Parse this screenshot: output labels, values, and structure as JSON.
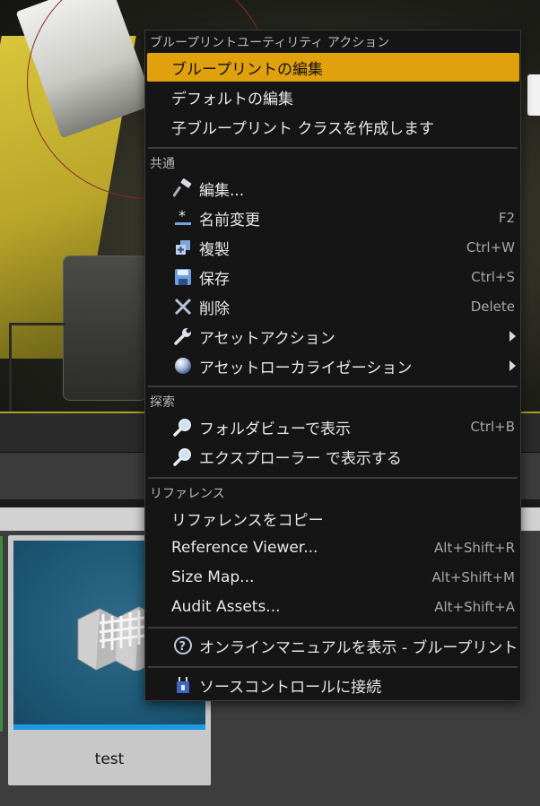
{
  "menu": {
    "sections": {
      "blueprint": "ブループリントユーティリティ アクション",
      "common": "共通",
      "explore": "探索",
      "reference": "リファレンス"
    },
    "blueprint_items": [
      {
        "label": "ブループリントの編集"
      },
      {
        "label": "デフォルトの編集"
      },
      {
        "label": "子ブループリント クラスを作成します"
      }
    ],
    "common_items": [
      {
        "label": "編集...",
        "shortcut": "",
        "icon": "hammer-icon"
      },
      {
        "label": "名前変更",
        "shortcut": "F2",
        "icon": "rename-star-icon"
      },
      {
        "label": "複製",
        "shortcut": "Ctrl+W",
        "icon": "duplicate-icon"
      },
      {
        "label": "保存",
        "shortcut": "Ctrl+S",
        "icon": "save-disk-icon"
      },
      {
        "label": "削除",
        "shortcut": "Delete",
        "icon": "delete-x-icon"
      },
      {
        "label": "アセットアクション",
        "shortcut": "",
        "icon": "wrench-icon"
      },
      {
        "label": "アセットローカライゼーション",
        "shortcut": "",
        "icon": "globe-icon"
      }
    ],
    "explore_items": [
      {
        "label": "フォルダビューで表示",
        "shortcut": "Ctrl+B",
        "icon": "magnifier-icon"
      },
      {
        "label": "エクスプローラー で表示する",
        "shortcut": "",
        "icon": "magnifier-icon"
      }
    ],
    "reference_items": [
      {
        "label": "リファレンスをコピー",
        "shortcut": ""
      },
      {
        "label": "Reference Viewer...",
        "shortcut": "Alt+Shift+R"
      },
      {
        "label": "Size Map...",
        "shortcut": "Alt+Shift+M"
      },
      {
        "label": "Audit Assets...",
        "shortcut": "Alt+Shift+A"
      }
    ],
    "help_item": {
      "label": "オンラインマニュアルを表示 - ブループリント",
      "icon": "help-circle-icon"
    },
    "source_item": {
      "label": "ソースコントロールに接続",
      "icon": "plug-icon"
    },
    "highlight_color": "#e0a10c"
  },
  "asset": {
    "name": "test",
    "icon": "map-icon"
  }
}
